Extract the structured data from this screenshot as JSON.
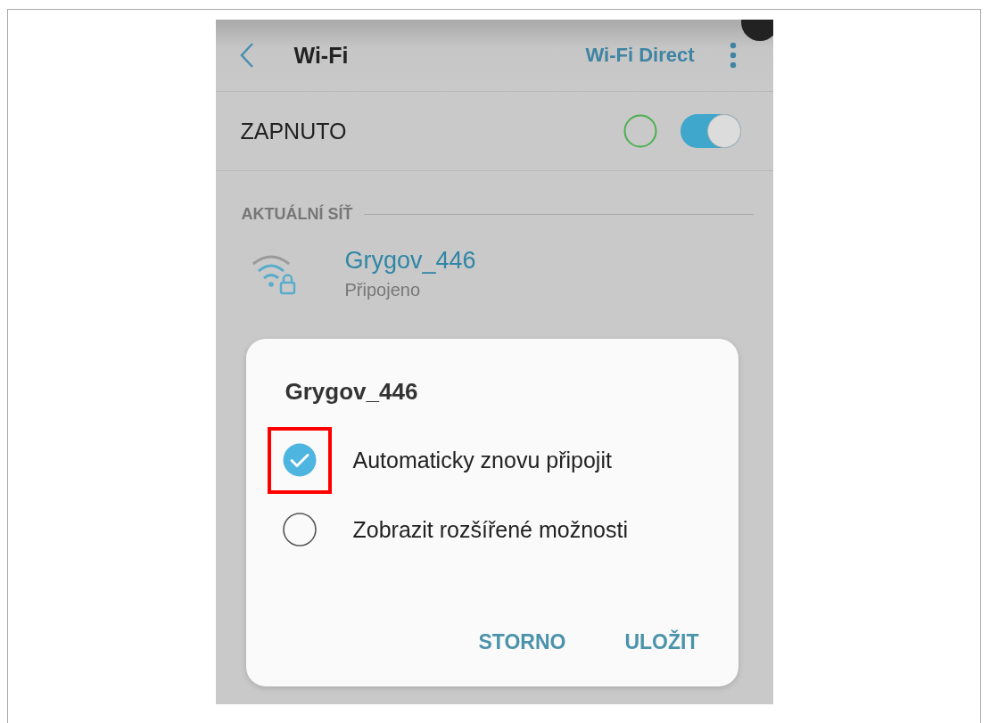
{
  "header": {
    "title": "Wi-Fi",
    "action": "Wi-Fi Direct"
  },
  "master_switch": {
    "label": "ZAPNUTO",
    "on": true
  },
  "section": {
    "title": "AKTUÁLNÍ SÍŤ"
  },
  "current_network": {
    "name": "Grygov_446",
    "status": "Připojeno"
  },
  "dialog": {
    "title": "Grygov_446",
    "options": [
      {
        "label": "Automaticky znovu připojit",
        "checked": true,
        "highlighted": true
      },
      {
        "label": "Zobrazit rozšířené možnosti",
        "checked": false,
        "highlighted": false
      }
    ],
    "buttons": [
      "STORNO",
      "ULOŽIT"
    ]
  }
}
